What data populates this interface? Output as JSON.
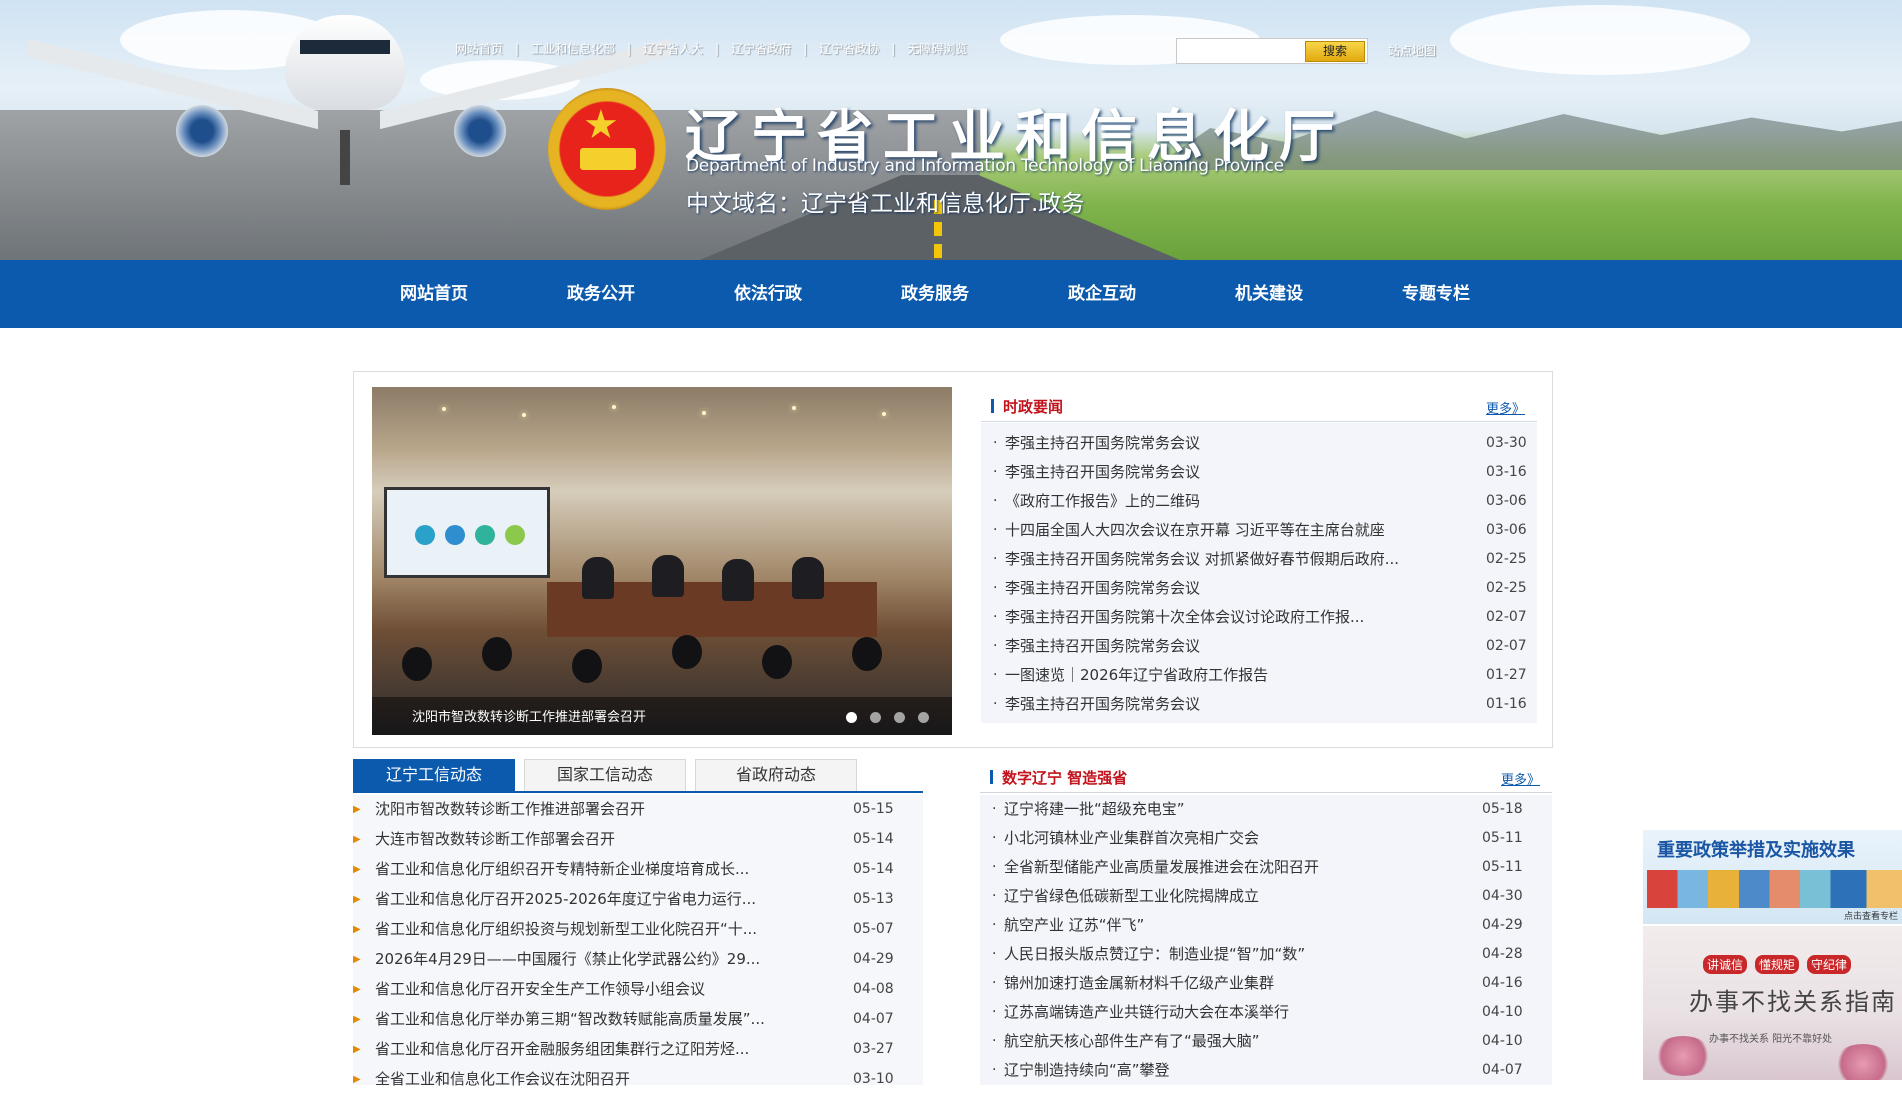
{
  "header": {
    "title": "辽宁省工业和信息化厅",
    "subtitle": "Department of Industry and Information Technology of Liaoning Province",
    "domain": "中文域名：辽宁省工业和信息化厅.政务",
    "top_links": [
      "网站首页",
      "工业和信息化部",
      "辽宁省人大",
      "辽宁省政府",
      "辽宁省政协",
      "无障碍浏览"
    ],
    "search_placeholder": "",
    "search_button": "搜索",
    "right_link": "站点地图"
  },
  "nav": {
    "items": [
      "网站首页",
      "政务公开",
      "依法行政",
      "政务服务",
      "政企互动",
      "机关建设",
      "专题专栏"
    ]
  },
  "slider": {
    "caption": "沈阳市智改数转诊断工作推进部署会召开",
    "dot_count": 4,
    "active_dot": 0
  },
  "policy_news": {
    "title": "时政要闻",
    "more": "更多》",
    "items": [
      {
        "title": "李强主持召开国务院常务会议",
        "date": "03-30"
      },
      {
        "title": "李强主持召开国务院常务会议",
        "date": "03-16"
      },
      {
        "title": "《政府工作报告》上的二维码",
        "date": "03-06"
      },
      {
        "title": "十四届全国人大四次会议在京开幕 习近平等在主席台就座",
        "date": "03-06"
      },
      {
        "title": "李强主持召开国务院常务会议 对抓紧做好春节假期后政府...",
        "date": "02-25"
      },
      {
        "title": "李强主持召开国务院常务会议",
        "date": "02-25"
      },
      {
        "title": "李强主持召开国务院第十次全体会议讨论政府工作报...",
        "date": "02-07"
      },
      {
        "title": "李强主持召开国务院常务会议",
        "date": "02-07"
      },
      {
        "title": "一图速览｜2026年辽宁省政府工作报告",
        "date": "01-27"
      },
      {
        "title": "李强主持召开国务院常务会议",
        "date": "01-16"
      }
    ]
  },
  "tabs": {
    "labels": [
      "辽宁工信动态",
      "国家工信动态",
      "省政府动态"
    ],
    "active": 0,
    "items": [
      {
        "title": "沈阳市智改数转诊断工作推进部署会召开",
        "date": "05-15"
      },
      {
        "title": "大连市智改数转诊断工作部署会召开",
        "date": "05-14"
      },
      {
        "title": "省工业和信息化厅组织召开专精特新企业梯度培育成长...",
        "date": "05-14"
      },
      {
        "title": "省工业和信息化厅召开2025-2026年度辽宁省电力运行...",
        "date": "05-13"
      },
      {
        "title": "省工业和信息化厅组织投资与规划新型工业化院召开“十...",
        "date": "05-07"
      },
      {
        "title": "2026年4月29日——中国履行《禁止化学武器公约》29...",
        "date": "04-29"
      },
      {
        "title": "省工业和信息化厅召开安全生产工作领导小组会议",
        "date": "04-08"
      },
      {
        "title": "省工业和信息化厅举办第三期“智改数转赋能高质量发展”...",
        "date": "04-07"
      },
      {
        "title": "省工业和信息化厅召开金融服务组团集群行之辽阳芳烃...",
        "date": "03-27"
      },
      {
        "title": "全省工业和信息化工作会议在沈阳召开",
        "date": "03-10"
      }
    ]
  },
  "digital_news": {
    "title": "数字辽宁 智造强省",
    "more": "更多》",
    "items": [
      {
        "title": "辽宁将建一批“超级充电宝”",
        "date": "05-18"
      },
      {
        "title": "小北河镇林业产业集群首次亮相广交会",
        "date": "05-11"
      },
      {
        "title": "全省新型储能产业高质量发展推进会在沈阳召开",
        "date": "05-11"
      },
      {
        "title": "辽宁省绿色低碳新型工业化院揭牌成立",
        "date": "04-30"
      },
      {
        "title": "航空产业 辽苏“伴飞”",
        "date": "04-29"
      },
      {
        "title": "人民日报头版点赞辽宁：制造业提“智”加“数”",
        "date": "04-28"
      },
      {
        "title": "锦州加速打造金属新材料千亿级产业集群",
        "date": "04-16"
      },
      {
        "title": "辽苏高端铸造产业共链行动大会在本溪举行",
        "date": "04-10"
      },
      {
        "title": "航空航天核心部件生产有了“最强大脑”",
        "date": "04-10"
      },
      {
        "title": "辽宁制造持续向“高”攀登",
        "date": "04-07"
      }
    ]
  },
  "promos": {
    "policy_title": "重要政策举措及实施效果",
    "policy_sub": "点击查看专栏",
    "guide_badges": [
      "讲诚信",
      "懂规矩",
      "守纪律"
    ],
    "guide_title": "办事不找关系指南",
    "guide_sub": "办事不找关系 阳光不靠好处"
  },
  "colors": {
    "nav_blue": "#0c5aad",
    "headline_red": "#c2131c",
    "list_bg": "#f3f5fa"
  }
}
